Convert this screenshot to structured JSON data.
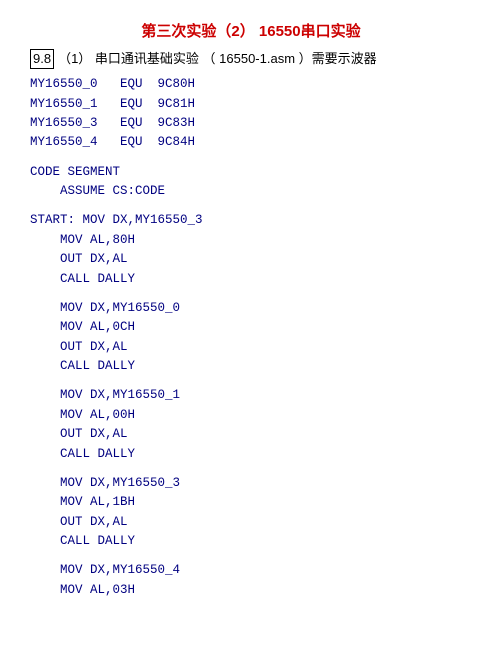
{
  "title": "第三次实验（2）   16550串口实验",
  "section": {
    "number": "9.8",
    "text": "（1）  串口通讯基础实验  （ 16550-1.asm ）需要示波器"
  },
  "code": {
    "equates": [
      "MY16550_0   EQU  9C80H",
      "MY16550_1   EQU  9C81H",
      "MY16550_3   EQU  9C83H",
      "MY16550_4   EQU  9C84H"
    ],
    "segment_start": [
      "CODE SEGMENT",
      "    ASSUME CS:CODE",
      "",
      "START: MOV DX,MY16550_3",
      "    MOV AL,80H",
      "    OUT DX,AL",
      "    CALL DALLY",
      "",
      "    MOV DX,MY16550_0",
      "    MOV AL,0CH",
      "    OUT DX,AL",
      "    CALL DALLY",
      "",
      "    MOV DX,MY16550_1",
      "    MOV AL,00H",
      "    OUT DX,AL",
      "    CALL DALLY",
      "",
      "    MOV DX,MY16550_3",
      "    MOV AL,1BH",
      "    OUT DX,AL",
      "    CALL DALLY",
      "",
      "    MOV DX,MY16550_4",
      "    MOV AL,03H"
    ]
  }
}
